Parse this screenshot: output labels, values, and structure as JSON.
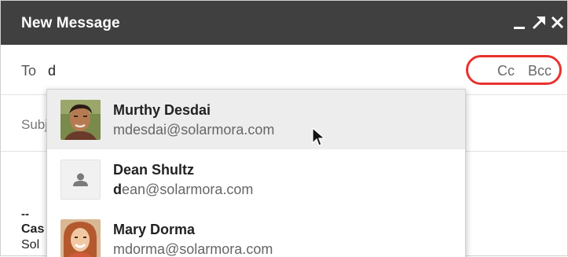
{
  "window": {
    "title": "New Message",
    "controls": [
      {
        "name": "minimize-icon",
        "glyph": "minimize"
      },
      {
        "name": "popout-icon",
        "glyph": "arrow-up-right"
      },
      {
        "name": "close-icon",
        "glyph": "x"
      }
    ]
  },
  "compose": {
    "to_label": "To",
    "to_value": "d",
    "cc_label": "Cc",
    "bcc_label": "Bcc",
    "highlight_color": "#e8322e",
    "subject_placeholder": "Subject"
  },
  "signature": {
    "dash": "--",
    "name": "Cas",
    "title": "Sol"
  },
  "suggestions": {
    "query": "d",
    "items": [
      {
        "name": "Murthy Desdai",
        "email_prefix": "",
        "email_rest": "mdesdai@solarmora.com",
        "avatar": "photo-man",
        "highlighted": true
      },
      {
        "name": "Dean Shultz",
        "email_prefix": "d",
        "email_rest": "ean@solarmora.com",
        "avatar": "generic-person-icon",
        "highlighted": false
      },
      {
        "name": "Mary Dorma",
        "email_prefix": "",
        "email_rest": "mdorma@solarmora.com",
        "avatar": "photo-woman",
        "highlighted": false
      }
    ]
  }
}
